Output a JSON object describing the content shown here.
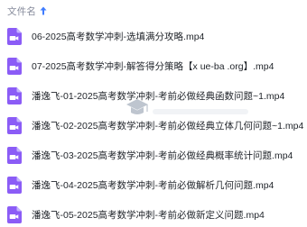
{
  "header": {
    "column_label": "文件名",
    "sort_icon": "arrow-up-icon"
  },
  "files": [
    {
      "name": "06-2025高考数学冲刺-选填满分攻略.mp4",
      "icon": "video-file-icon"
    },
    {
      "name": "07-2025高考数学冲刺-解答得分策略【x ue-ba .org】.mp4",
      "icon": "video-file-icon"
    },
    {
      "name": "潘逸飞-01-2025高考数学冲刺-考前必做经典函数问题~1.mp4",
      "icon": "video-file-icon"
    },
    {
      "name": "潘逸飞-02-2025高考数学冲刺-考前必做经典立体几何问题~1.mp4",
      "icon": "video-file-icon"
    },
    {
      "name": "潘逸飞-03-2025高考数学冲刺-考前必做经典概率统计问题.mp4",
      "icon": "video-file-icon"
    },
    {
      "name": "潘逸飞-04-2025高考数学冲刺-考前必做解析几何问题.mp4",
      "icon": "video-file-icon"
    },
    {
      "name": "潘逸飞-05-2025高考数学冲刺-考前必做新定义问题.mp4",
      "icon": "video-file-icon"
    }
  ],
  "colors": {
    "icon_purple": "#8b5cf6",
    "icon_fold": "#c4b5fd",
    "header_text": "#878c9c",
    "sort_arrow": "#3f7cff",
    "file_text": "#1f2329"
  },
  "watermark_icon": "graduation-cap-logo"
}
